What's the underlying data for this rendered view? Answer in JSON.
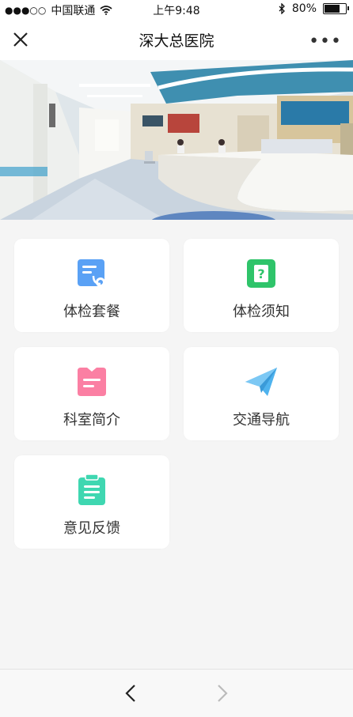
{
  "status_bar": {
    "signal": "●●●○○",
    "carrier": "中国联通",
    "time": "上午9:48",
    "battery": "80%",
    "battery_level": 0.8
  },
  "nav": {
    "title": "深大总医院"
  },
  "menu": [
    {
      "label": "体检套餐",
      "icon": "checkup-package-icon",
      "color": "#5aa1f5"
    },
    {
      "label": "体检须知",
      "icon": "question-notice-icon",
      "color": "#2fc46a"
    },
    {
      "label": "科室简介",
      "icon": "department-intro-icon",
      "color": "#fb7fa3"
    },
    {
      "label": "交通导航",
      "icon": "paper-plane-icon",
      "color": "#4fb3ee"
    },
    {
      "label": "意见反馈",
      "icon": "clipboard-feedback-icon",
      "color": "#3fd7b1"
    }
  ],
  "colors": {
    "page_background": "#f5f5f5",
    "card_background": "#ffffff"
  }
}
